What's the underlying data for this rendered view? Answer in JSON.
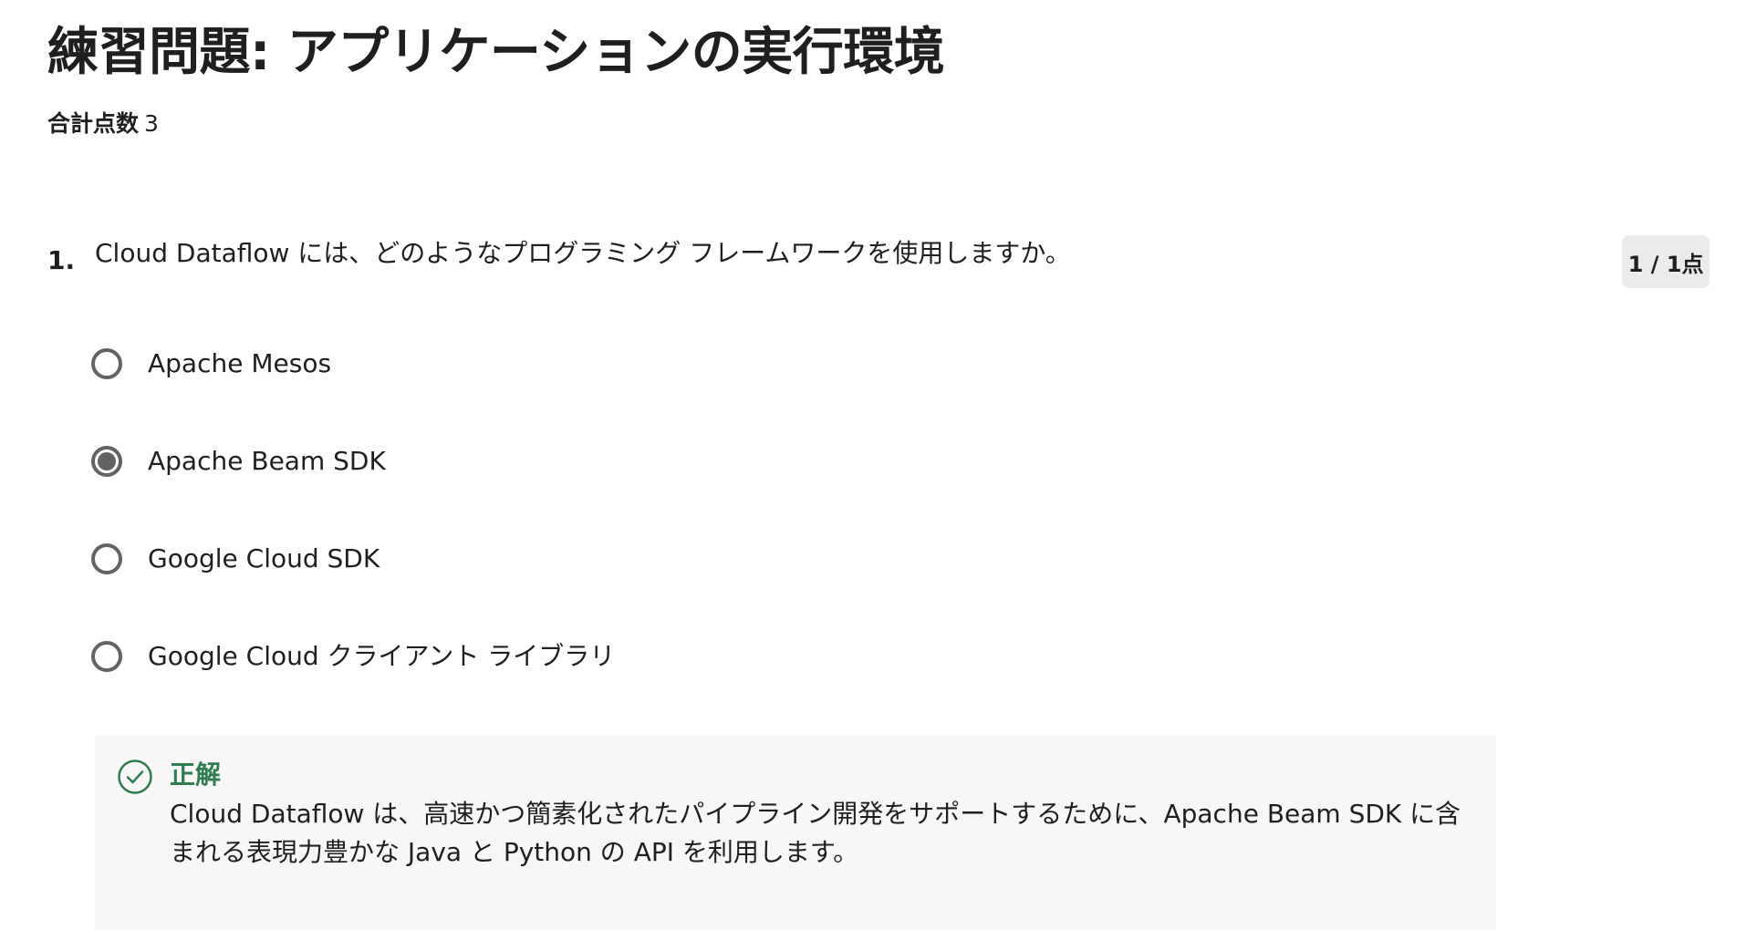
{
  "quiz": {
    "title": "練習問題: アプリケーションの実行環境",
    "score_label": "合計点数",
    "score_value": "3"
  },
  "question": {
    "number": "1.",
    "text": "Cloud Dataflow には、どのようなプログラミング フレームワークを使用しますか。",
    "points": "1 / 1点",
    "options": [
      {
        "label": "Apache Mesos",
        "selected": false
      },
      {
        "label": "Apache Beam SDK",
        "selected": true
      },
      {
        "label": "Google Cloud SDK",
        "selected": false
      },
      {
        "label": "Google Cloud クライアント ライブラリ",
        "selected": false
      }
    ],
    "feedback": {
      "status": "正解",
      "explanation": "Cloud Dataflow は、高速かつ簡素化されたパイプライン開発をサポートするために、Apache Beam SDK に含まれる表現力豊かな Java と Python の API を利用します。",
      "status_color": "#2e7d4f",
      "icon": "check-circle-icon"
    }
  }
}
